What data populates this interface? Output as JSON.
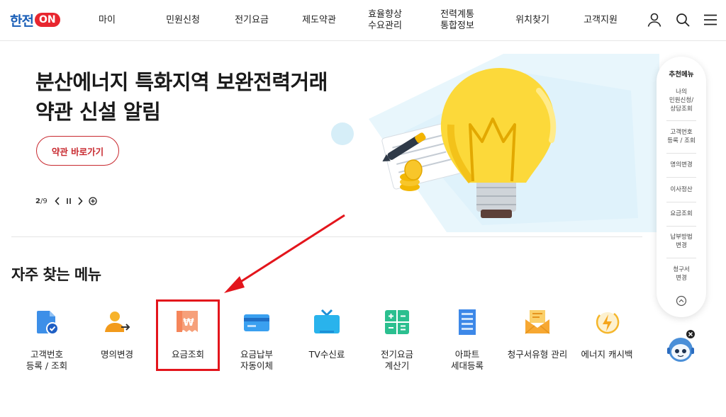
{
  "header": {
    "logo_text": "한전",
    "logo_on": "ON",
    "nav": [
      "마이",
      "민원신청",
      "전기요금",
      "제도약관",
      "효율향상\n수요관리",
      "전력계통\n통합정보",
      "위치찾기",
      "고객지원"
    ],
    "icons": [
      "user-icon",
      "search-icon",
      "menu-icon"
    ]
  },
  "hero": {
    "title": "분산에너지 특화지역 보완전력거래\n약관 신설 알림",
    "button_label": "약관 바로가기",
    "page_current": "2",
    "page_total": "/9"
  },
  "frequent": {
    "title": "자주 찾는 메뉴",
    "items": [
      {
        "label": "고객번호\n등록 / 조회",
        "icon": "customer-number-icon"
      },
      {
        "label": "명의변경",
        "icon": "name-change-icon"
      },
      {
        "label": "요금조회",
        "icon": "bill-inquiry-icon"
      },
      {
        "label": "요금납부\n자동이체",
        "icon": "card-icon"
      },
      {
        "label": "TV수신료",
        "icon": "tv-icon"
      },
      {
        "label": "전기요금\n계산기",
        "icon": "calculator-icon"
      },
      {
        "label": "아파트\n세대등록",
        "icon": "apartment-icon"
      },
      {
        "label": "청구서유형 관리",
        "icon": "mail-icon"
      },
      {
        "label": "에너지 캐시백",
        "icon": "energy-cashback-icon"
      }
    ]
  },
  "recommend": {
    "title": "추천메뉴",
    "items": [
      "나의\n민원신청/\n상담조회",
      "고객번호\n등록 / 조회",
      "명의변경",
      "이사정산",
      "요금조회",
      "납부방법\n변경",
      "청구서\n변경"
    ]
  },
  "colors": {
    "brand_blue": "#1b5fb7",
    "brand_red": "#c8292f",
    "highlight_red": "#e3151c"
  }
}
